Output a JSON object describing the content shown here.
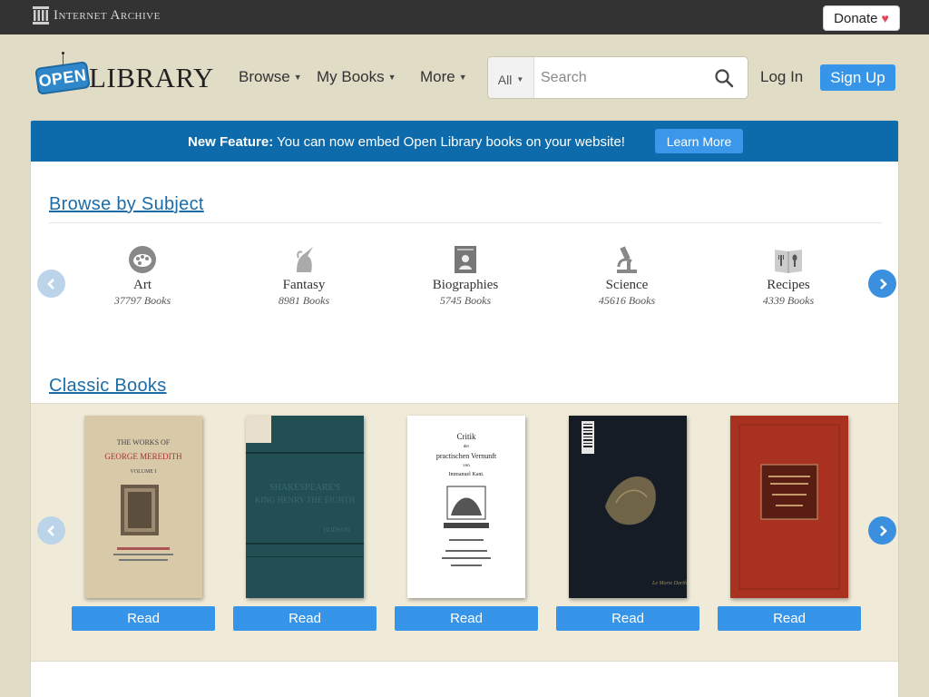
{
  "topbar": {
    "ia_name": "Internet Archive",
    "donate_label": "Donate",
    "donate_heart": "♥"
  },
  "header": {
    "logo_open": "OPEN",
    "logo_library": "LIBRARY",
    "nav": [
      {
        "label": "Browse"
      },
      {
        "label": "My Books"
      },
      {
        "label": "More"
      }
    ],
    "search": {
      "scope": "All",
      "placeholder": "Search",
      "icon": "search-icon"
    },
    "login_label": "Log In",
    "signup_label": "Sign Up"
  },
  "banner": {
    "bold": "New Feature:",
    "text": " You can now embed Open Library books on your website!",
    "button": "Learn More"
  },
  "browse_subject": {
    "title": "Browse by Subject",
    "subjects": [
      {
        "name": "Art",
        "count": "37797 Books",
        "icon": "palette-icon"
      },
      {
        "name": "Fantasy",
        "count": "8981 Books",
        "icon": "unicorn-icon"
      },
      {
        "name": "Biographies",
        "count": "5745 Books",
        "icon": "portrait-book-icon"
      },
      {
        "name": "Science",
        "count": "45616 Books",
        "icon": "microscope-icon"
      },
      {
        "name": "Recipes",
        "count": "4339 Books",
        "icon": "cookbook-icon"
      }
    ]
  },
  "classic_books": {
    "title": "Classic Books",
    "books": [
      {
        "read_label": "Read",
        "cover_lines": [
          "THE WORKS OF",
          "GEORGE MEREDITH",
          "VOLUME I"
        ],
        "cover_color": "#d6c7a8"
      },
      {
        "read_label": "Read",
        "cover_lines": [
          "SHAKESPEARE'S",
          "KING HENRY THE EIGHTH",
          "HUDSON"
        ],
        "cover_color": "#1f4e52"
      },
      {
        "read_label": "Read",
        "cover_lines": [
          "Critik",
          "der",
          "practischen Vernunft",
          "von",
          "Immanuel Kant."
        ],
        "cover_color": "#ffffff"
      },
      {
        "read_label": "Read",
        "cover_lines": [],
        "cover_color": "#141a24"
      },
      {
        "read_label": "Read",
        "cover_lines": [],
        "cover_color": "#a8321f"
      }
    ]
  },
  "colors": {
    "topbar": "#333333",
    "background": "#e1dcc5",
    "banner": "#0d6bab",
    "accent_button": "#3795e9",
    "link": "#1b6ca8"
  }
}
